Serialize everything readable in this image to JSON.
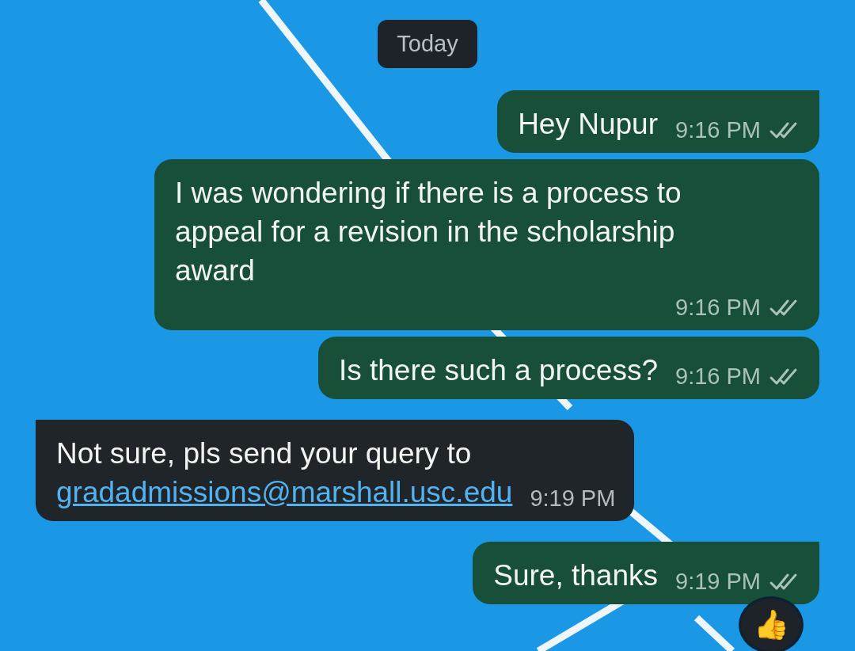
{
  "date_chip": "Today",
  "messages": [
    {
      "kind": "sent",
      "tail": true,
      "text": "Hey Nupur",
      "time": "9:16 PM",
      "read": false
    },
    {
      "kind": "sent",
      "tail": false,
      "text": "I was wondering if there is a process to appeal for a revision in the scholarship award",
      "time": "9:16 PM",
      "read": false
    },
    {
      "kind": "sent",
      "tail": false,
      "text": "Is there such a process?",
      "time": "9:16 PM",
      "read": false
    },
    {
      "kind": "received",
      "tail": true,
      "text": "Not sure, pls send your query to",
      "link": "gradadmissions@marshall.usc.edu",
      "time": "9:19 PM"
    },
    {
      "kind": "sent",
      "tail": true,
      "text": "Sure, thanks",
      "time": "9:19 PM",
      "read": false,
      "reaction": "👍"
    }
  ]
}
